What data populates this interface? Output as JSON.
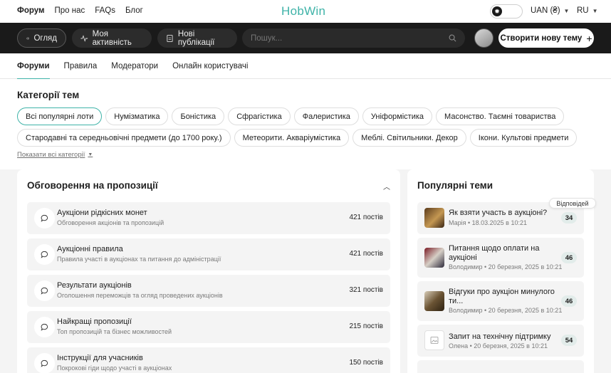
{
  "topnav": {
    "items": [
      "Форум",
      "Про нас",
      "FAQs",
      "Блог"
    ],
    "logo": "HobWin",
    "currency": "UAN (₴)",
    "language": "RU"
  },
  "toolbar": {
    "overview": "Огляд",
    "activity": "Моя активність",
    "new_posts": "Нові публікації",
    "search_placeholder": "Пошук...",
    "create_topic": "Створити нову тему"
  },
  "tabs": [
    "Форуми",
    "Правила",
    "Модератори",
    "Онлайн користувачі"
  ],
  "categories": {
    "title": "Категорії тем",
    "row1": [
      "Всі популярні лоти",
      "Нумізматика",
      "Боністика",
      "Сфрагістика",
      "Фалеристика",
      "Уніформістика",
      "Масонство. Таємні товариства"
    ],
    "row2": [
      "Стародавні та середньовічні предмети (до 1700 року.)",
      "Метеорити. Акваріумістика",
      "Меблі. Світильники. Декор",
      "Ікони. Культові предмети"
    ],
    "show_all": "Показати всі категорії"
  },
  "discussions": {
    "title": "Обговорення на пропозиції",
    "items": [
      {
        "name": "Аукціони рідкісних монет",
        "desc": "Обговорення акціонів та пропозицій",
        "count": "421 постів"
      },
      {
        "name": "Аукціонні правила",
        "desc": "Правила участі в аукціонах та питання до адміністрації",
        "count": "421 постів"
      },
      {
        "name": "Результати аукціонів",
        "desc": "Оголошення переможців та огляд проведених аукціонів",
        "count": "321 постів"
      },
      {
        "name": "Найкращі пропозиції",
        "desc": "Топ пропозицій та бізнес можливостей",
        "count": "215 постів"
      },
      {
        "name": "Інструкції для учасників",
        "desc": "Покрокові гіди щодо участі в аукціонах",
        "count": "150 постів"
      }
    ]
  },
  "popular": {
    "title": "Популярні теми",
    "replies_tooltip": "Відповідей",
    "items": [
      {
        "title": "Як взяти участь в аукціоні?",
        "author": "Марія",
        "date": "18.03.2025 в 10:21",
        "count": "34"
      },
      {
        "title": "Питання щодо оплати на аукціоні",
        "author": "Володимир",
        "date": "20 березня, 2025 в 10:21",
        "count": "46"
      },
      {
        "title": "Відгуки про аукціон минулого ти...",
        "author": "Володимир",
        "date": "20 березня, 2025 в 10:21",
        "count": "46"
      },
      {
        "title": "Запит на технічну підтримку",
        "author": "Олена",
        "date": "20 березня, 2025 в 10:21",
        "count": "54"
      }
    ]
  },
  "colors": {
    "accent": "#3fb3a8",
    "dark": "#1a1a1a",
    "panel_bg": "#f4f4f4"
  }
}
